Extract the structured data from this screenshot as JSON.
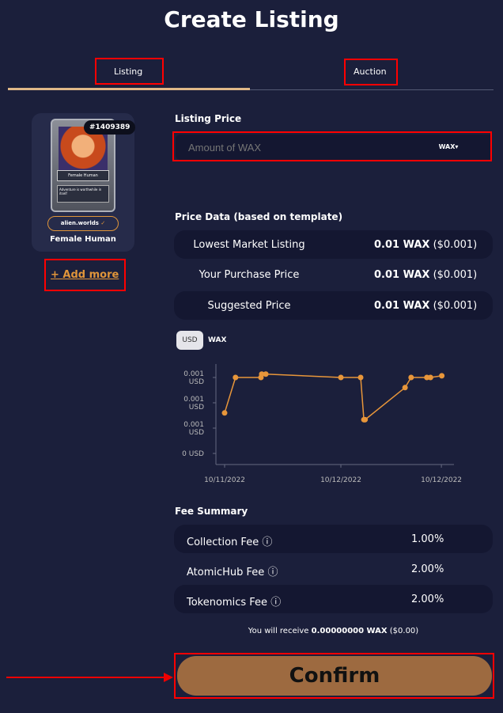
{
  "page": {
    "title": "Create Listing"
  },
  "tabs": [
    {
      "label": "Listing",
      "active": true
    },
    {
      "label": "Auction",
      "active": false
    }
  ],
  "nft": {
    "id": "#1409389",
    "card_name": "Female Human",
    "card_subtitle": "Human",
    "card_text": "Adventure is worthwhile in itself",
    "collection": "alien.worlds",
    "name": "Female Human",
    "add_more": "Add more"
  },
  "listing": {
    "label": "Listing Price",
    "placeholder": "Amount of WAX",
    "value": "",
    "currency": "WAX"
  },
  "price_data": {
    "heading": "Price Data (based on template)",
    "rows": [
      {
        "label": "Lowest Market Listing",
        "value": "0.01 WAX",
        "usd": "($0.001)"
      },
      {
        "label": "Your Purchase Price",
        "value": "0.01 WAX",
        "usd": "($0.001)"
      },
      {
        "label": "Suggested Price",
        "value": "0.01 WAX",
        "usd": "($0.001)"
      }
    ]
  },
  "chart_toggle": {
    "usd": "USD",
    "wax": "WAX",
    "selected": "USD"
  },
  "chart_data": {
    "type": "line",
    "color": "#e8963a",
    "grid": false,
    "x_ticks": [
      "10/11/2022",
      "10/12/2022",
      "10/12/2022"
    ],
    "x_tick_times": [
      "2022-10-11 00:00",
      "2022-10-12 00:00",
      "2022-10-12 20:45"
    ],
    "y_ticks": [
      {
        "value": 0.0009,
        "label": "0.001 USD"
      },
      {
        "value": 0.0006,
        "label": "0.001 USD"
      },
      {
        "value": 0.0003,
        "label": "0.001 USD"
      },
      {
        "value": 0,
        "label": "0 USD"
      }
    ],
    "ylim": [
      0,
      0.001
    ],
    "points": [
      [
        "2022-10-11 00:00",
        0.00048
      ],
      [
        "2022-10-11 02:15",
        0.0009
      ],
      [
        "2022-10-11 07:30",
        0.0009
      ],
      [
        "2022-10-11 07:40",
        0.00094
      ],
      [
        "2022-10-11 08:30",
        0.00094
      ],
      [
        "2022-10-12 00:00",
        0.0009
      ],
      [
        "2022-10-12 04:05",
        0.0009
      ],
      [
        "2022-10-12 04:45",
        0.0004
      ],
      [
        "2022-10-12 05:00",
        0.0004
      ],
      [
        "2022-10-12 13:15",
        0.00078
      ],
      [
        "2022-10-12 14:30",
        0.0009
      ],
      [
        "2022-10-12 17:45",
        0.0009
      ],
      [
        "2022-10-12 18:30",
        0.0009
      ],
      [
        "2022-10-12 20:50",
        0.00092
      ]
    ]
  },
  "fees": {
    "heading": "Fee Summary",
    "rows": [
      {
        "label": "Collection Fee",
        "value": "1.00%"
      },
      {
        "label": "AtomicHub Fee",
        "value": "2.00%"
      },
      {
        "label": "Tokenomics Fee",
        "value": "2.00%"
      }
    ],
    "receive_prefix": "You will receive",
    "receive_amount": "0.00000000 WAX",
    "receive_usd": "($0.00)"
  },
  "confirm": "Confirm",
  "colors": {
    "accent": "#e0953a",
    "confirm": "#9d6a40",
    "annotation": "#ff0000"
  }
}
